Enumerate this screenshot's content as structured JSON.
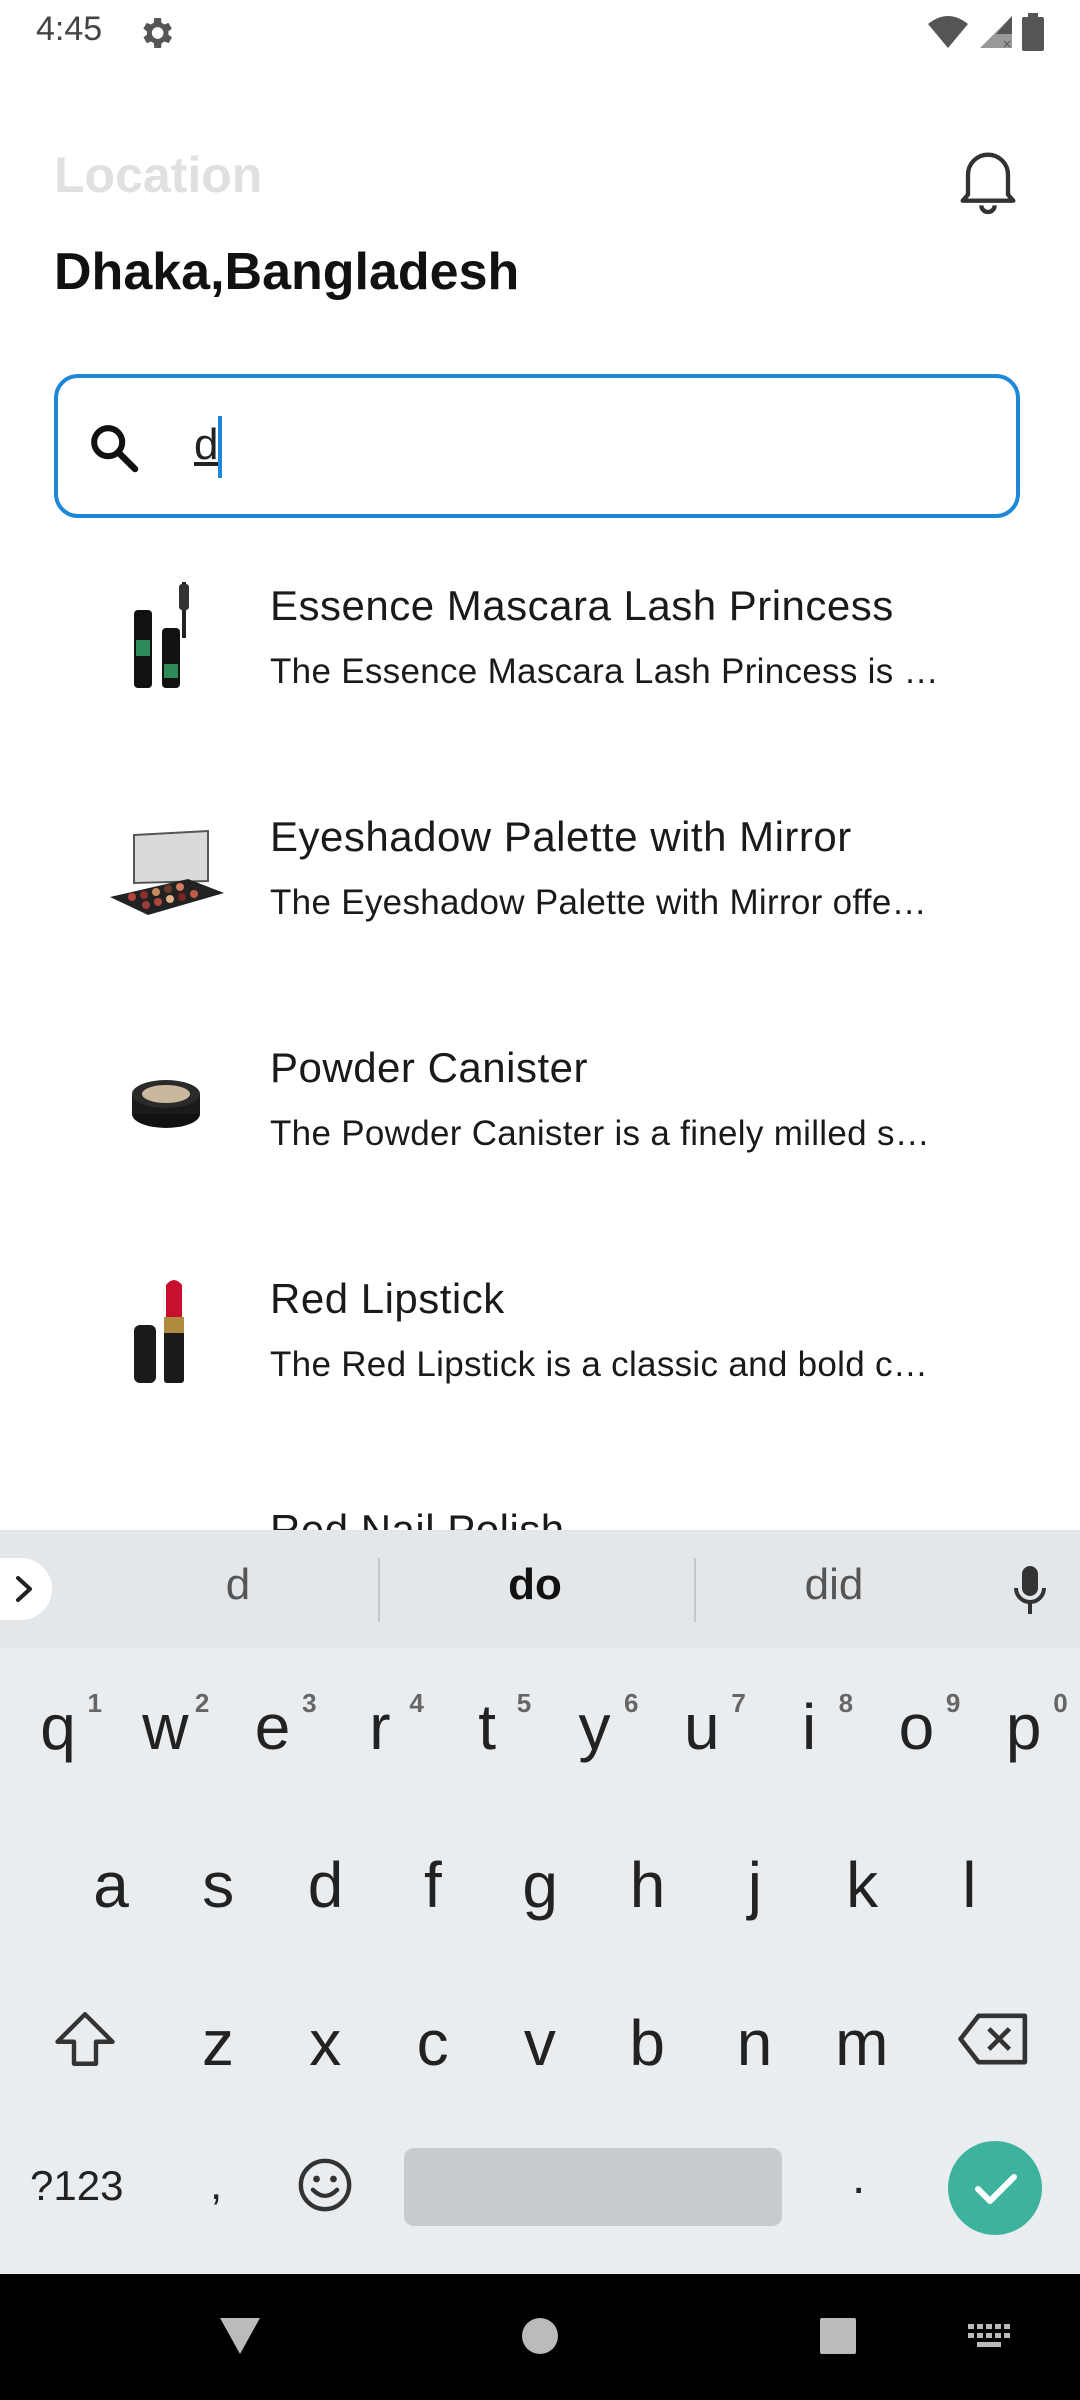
{
  "status": {
    "time": "4:45"
  },
  "header": {
    "location_label": "Location",
    "location_value": "Dhaka,Bangladesh"
  },
  "search": {
    "value": "d"
  },
  "results": [
    {
      "title": "Essence Mascara Lash Princess",
      "desc": "The Essence Mascara Lash Princess is …",
      "thumb": "mascara"
    },
    {
      "title": "Eyeshadow Palette with Mirror",
      "desc": "The Eyeshadow Palette with Mirror offe…",
      "thumb": "eyeshadow-palette"
    },
    {
      "title": "Powder Canister",
      "desc": "The Powder Canister is a finely milled s…",
      "thumb": "powder-canister"
    },
    {
      "title": "Red Lipstick",
      "desc": "The Red Lipstick is a classic and bold c…",
      "thumb": "lipstick"
    },
    {
      "title": "Red Nail Polish",
      "desc": "",
      "thumb": "nail-polish"
    }
  ],
  "keyboard": {
    "suggestions": [
      "d",
      "do",
      "did"
    ],
    "row1": [
      "q",
      "w",
      "e",
      "r",
      "t",
      "y",
      "u",
      "i",
      "o",
      "p"
    ],
    "row1_hints": [
      "1",
      "2",
      "3",
      "4",
      "5",
      "6",
      "7",
      "8",
      "9",
      "0"
    ],
    "row2": [
      "a",
      "s",
      "d",
      "f",
      "g",
      "h",
      "j",
      "k",
      "l"
    ],
    "row3": [
      "z",
      "x",
      "c",
      "v",
      "b",
      "n",
      "m"
    ],
    "symbols_label": "?123",
    "comma": ",",
    "period": "."
  },
  "colors": {
    "accent": "#1e88d8",
    "enter": "#3db39e"
  }
}
